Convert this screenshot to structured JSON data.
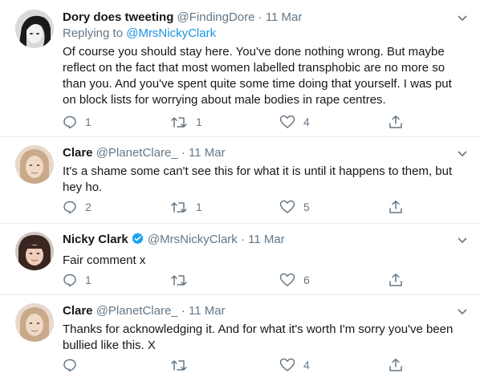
{
  "tweets": [
    {
      "name": "Dory does tweeting",
      "handle": "@FindingDore",
      "dot": "·",
      "date": "11 Mar",
      "replying_prefix": "Replying to ",
      "replying_to": "@MrsNickyClark",
      "text": "Of course you should stay here. You've done nothing wrong. But maybe reflect on the fact that most women labelled transphobic are no more so than you. And you've spent quite some time doing that yourself. I was put on block lists for worrying about male bodies in rape centres.",
      "replies": "1",
      "retweets": "1",
      "likes": "4"
    },
    {
      "name": "Clare",
      "handle": "@PlanetClare_",
      "dot": "·",
      "date": "11 Mar",
      "text": "It's a shame some can't see this for what it is until it happens to them, but hey ho.",
      "replies": "2",
      "retweets": "1",
      "likes": "5"
    },
    {
      "name": "Nicky Clark",
      "handle": "@MrsNickyClark",
      "dot": "·",
      "date": "11 Mar",
      "text": "Fair comment x",
      "replies": "1",
      "retweets": "",
      "likes": "6"
    },
    {
      "name": "Clare",
      "handle": "@PlanetClare_",
      "dot": "·",
      "date": "11 Mar",
      "text": "Thanks for acknowledging it. And for what it's worth I'm sorry you've been bullied like this. X",
      "replies": "",
      "retweets": "",
      "likes": "4"
    }
  ],
  "icons": {
    "reply": "reply-icon",
    "retweet": "retweet-icon",
    "like": "heart-icon",
    "share": "share-icon",
    "more": "chevron-down-icon",
    "verified": "verified-badge-icon"
  },
  "colors": {
    "text": "#14171a",
    "secondary": "#657786",
    "link": "#1b95e0",
    "verified": "#1da1f2",
    "divider": "#e6ecf0"
  }
}
